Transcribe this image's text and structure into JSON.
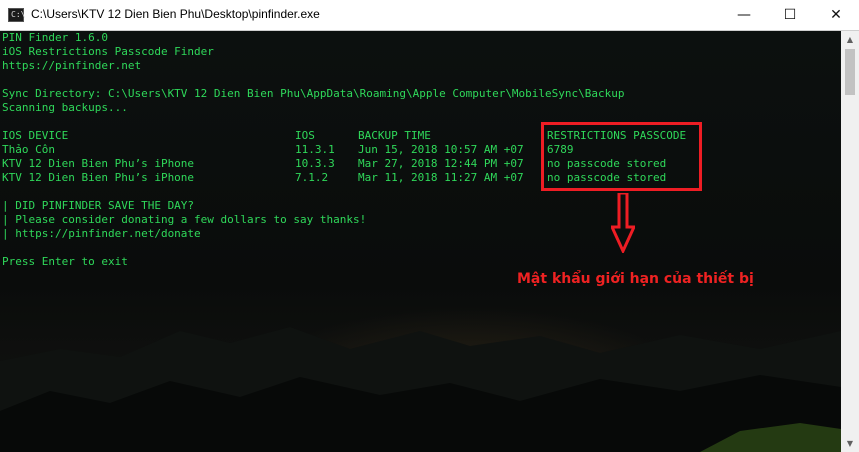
{
  "window": {
    "title": "C:\\Users\\KTV 12 Dien Bien Phu\\Desktop\\pinfinder.exe",
    "icon_text": "C:\\",
    "buttons": {
      "minimize": "—",
      "maximize": "☐",
      "close": "✕"
    }
  },
  "console": {
    "header": [
      "PIN Finder 1.6.0",
      "iOS Restrictions Passcode Finder",
      "https://pinfinder.net"
    ],
    "sync_directory": "Sync Directory: C:\\Users\\KTV 12 Dien Bien Phu\\AppData\\Roaming\\Apple Computer\\MobileSync\\Backup",
    "scanning": "Scanning backups...",
    "table": {
      "columns": [
        "IOS DEVICE",
        "IOS",
        "BACKUP TIME",
        "RESTRICTIONS PASSCODE"
      ],
      "rows": [
        [
          "Thảo Côn",
          "11.3.1",
          "Jun 15, 2018 10:57 AM +07",
          "6789"
        ],
        [
          "KTV 12 Dien Bien Phu’s iPhone",
          "10.3.3",
          "Mar 27, 2018 12:44 PM +07",
          "no passcode stored"
        ],
        [
          "KTV 12 Dien Bien Phu’s iPhone",
          "7.1.2",
          "Mar 11, 2018 11:27 AM +07",
          "no passcode stored"
        ]
      ]
    },
    "donate": [
      "| DID PINFINDER SAVE THE DAY?",
      "| Please consider donating a few dollars to say thanks!",
      "| https://pinfinder.net/donate"
    ],
    "prompt": "Press Enter to exit",
    "text_color": "#2fd85a"
  },
  "annotation": {
    "text": "Mật khẩu giới hạn của thiết bị",
    "color": "#ee2222"
  },
  "scrollbar": {
    "up": "▲",
    "down": "▼"
  }
}
